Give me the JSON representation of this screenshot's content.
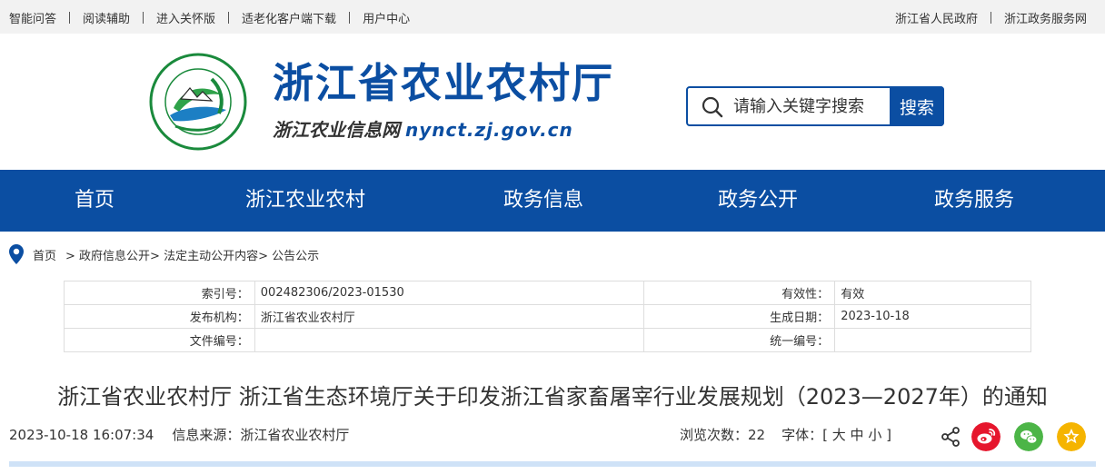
{
  "topbar": {
    "left": [
      "智能问答",
      "阅读辅助",
      "进入关怀版",
      "适老化客户端下载",
      "用户中心"
    ],
    "right": [
      "浙江省人民政府",
      "浙江政务服务网"
    ]
  },
  "header": {
    "title": "浙江省农业农村厅",
    "subtitle": "浙江农业信息网",
    "url": "nynct.zj.gov.cn",
    "search_placeholder": "请输入关键字搜索",
    "search_button": "搜索"
  },
  "nav": [
    "首页",
    "浙江农业农村",
    "政务信息",
    "政务公开",
    "政务服务"
  ],
  "breadcrumb": {
    "home": "首页",
    "path": [
      "> 政府信息公开",
      "> 法定主动公开内容",
      "> 公告公示"
    ]
  },
  "meta": {
    "rows": [
      {
        "k1": "索引号：",
        "v1": "002482306/2023-01530",
        "k2": "有效性：",
        "v2": "有效"
      },
      {
        "k1": "发布机构：",
        "v1": "浙江省农业农村厅",
        "k2": "生成日期：",
        "v2": "2023-10-18"
      },
      {
        "k1": "文件编号：",
        "v1": "",
        "k2": "统一编号：",
        "v2": ""
      }
    ]
  },
  "article": {
    "title": "浙江省农业农村厅 浙江省生态环境厅关于印发浙江省家畜屠宰行业发展规划（2023—2027年）的通知",
    "datetime": "2023-10-18 16:07:34",
    "source": "信息来源：浙江省农业农村厅",
    "views": "浏览次数：22",
    "font_label": "字体：[",
    "font_large": "大",
    "font_medium": "中",
    "font_small": "小",
    "font_end": "]"
  },
  "colors": {
    "brand": "#0b4ea2",
    "weibo": "#e6162d",
    "wechat": "#4cb547",
    "favorite": "#f5b400"
  }
}
